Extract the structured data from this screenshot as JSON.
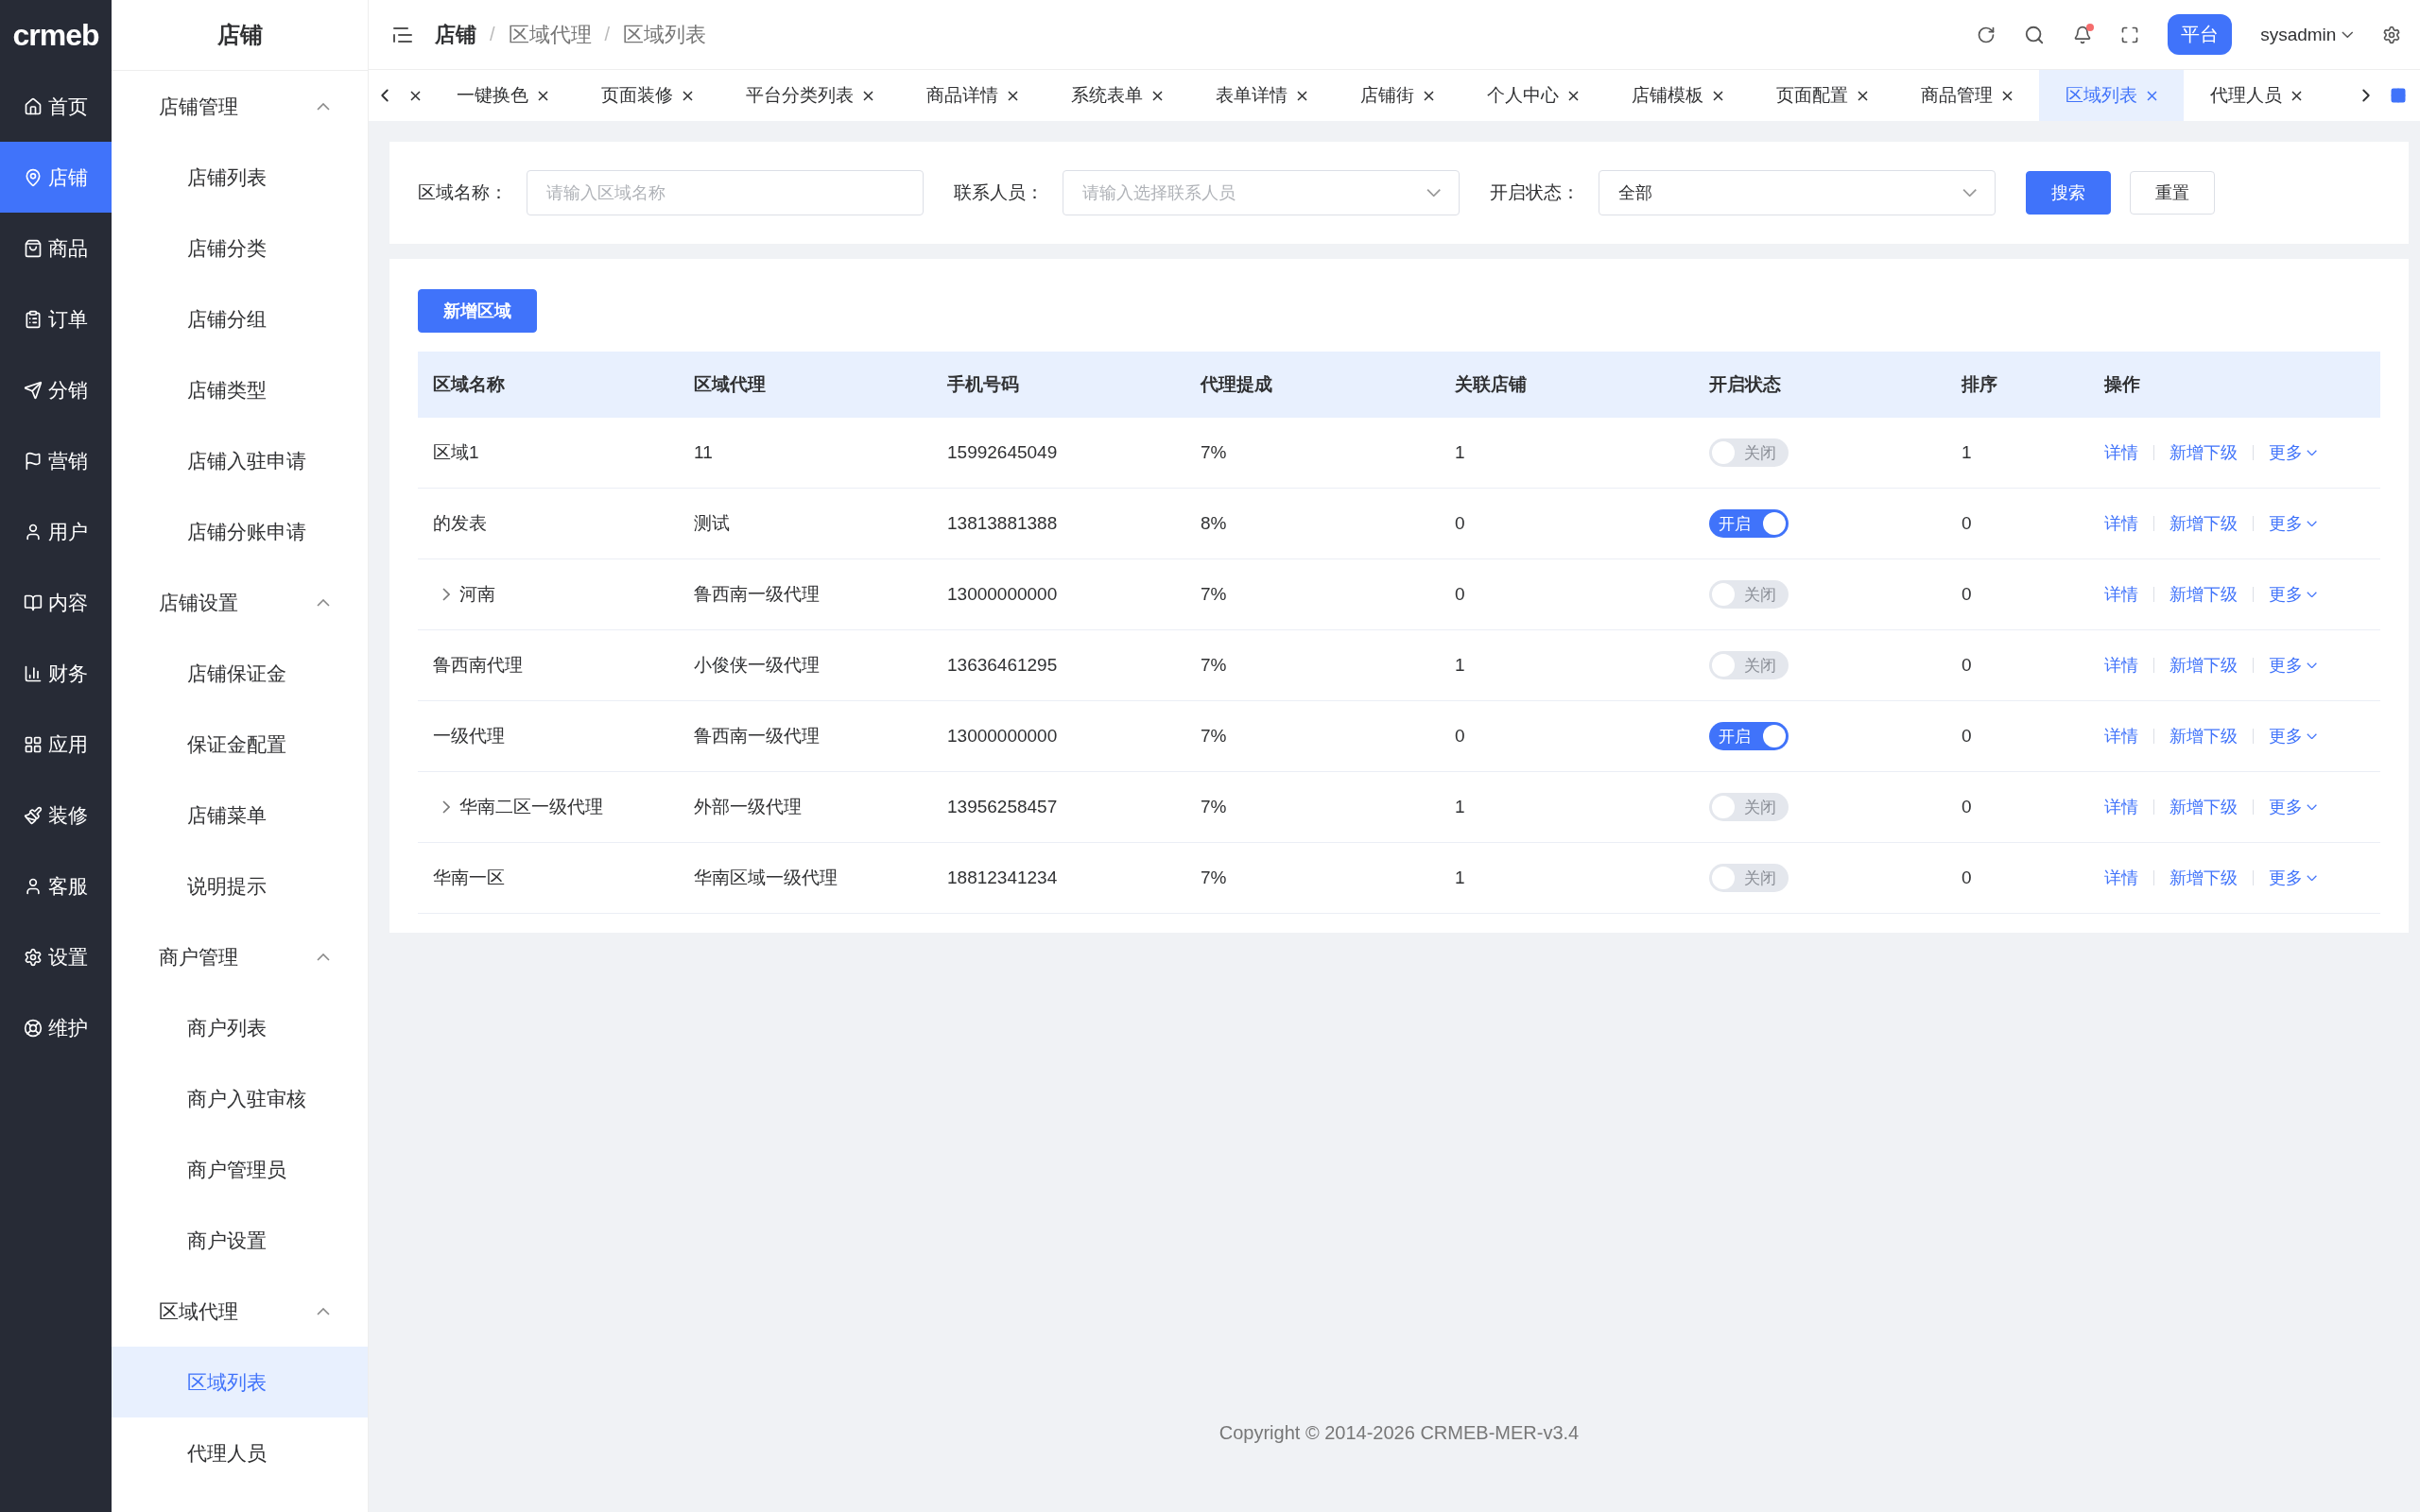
{
  "logo": "crmeb",
  "rail": [
    {
      "label": "首页",
      "selected": false
    },
    {
      "label": "店铺",
      "selected": true
    },
    {
      "label": "商品",
      "selected": false
    },
    {
      "label": "订单",
      "selected": false
    },
    {
      "label": "分销",
      "selected": false
    },
    {
      "label": "营销",
      "selected": false
    },
    {
      "label": "用户",
      "selected": false
    },
    {
      "label": "内容",
      "selected": false
    },
    {
      "label": "财务",
      "selected": false
    },
    {
      "label": "应用",
      "selected": false
    },
    {
      "label": "装修",
      "selected": false
    },
    {
      "label": "客服",
      "selected": false
    },
    {
      "label": "设置",
      "selected": false
    },
    {
      "label": "维护",
      "selected": false
    }
  ],
  "sidebar": {
    "title": "店铺",
    "groups": [
      {
        "label": "店铺管理",
        "expanded": true,
        "items": [
          {
            "label": "店铺列表",
            "selected": false
          },
          {
            "label": "店铺分类",
            "selected": false
          },
          {
            "label": "店铺分组",
            "selected": false
          },
          {
            "label": "店铺类型",
            "selected": false
          },
          {
            "label": "店铺入驻申请",
            "selected": false
          },
          {
            "label": "店铺分账申请",
            "selected": false
          }
        ]
      },
      {
        "label": "店铺设置",
        "expanded": true,
        "items": [
          {
            "label": "店铺保证金",
            "selected": false
          },
          {
            "label": "保证金配置",
            "selected": false
          },
          {
            "label": "店铺菜单",
            "selected": false
          },
          {
            "label": "说明提示",
            "selected": false
          }
        ]
      },
      {
        "label": "商户管理",
        "expanded": true,
        "items": [
          {
            "label": "商户列表",
            "selected": false
          },
          {
            "label": "商户入驻审核",
            "selected": false
          },
          {
            "label": "商户管理员",
            "selected": false
          },
          {
            "label": "商户设置",
            "selected": false
          }
        ]
      },
      {
        "label": "区域代理",
        "expanded": true,
        "items": [
          {
            "label": "区域列表",
            "selected": true
          },
          {
            "label": "代理人员",
            "selected": false
          }
        ]
      }
    ]
  },
  "breadcrumb": [
    "店铺",
    "区域代理",
    "区域列表"
  ],
  "breadcrumb_separators": [
    "/",
    "/"
  ],
  "header": {
    "platform_badge": "平台",
    "user": "sysadmin",
    "notification_dot": true
  },
  "tabs": [
    {
      "selected": false
    },
    {
      "label": "一键换色",
      "selected": false
    },
    {
      "label": "页面装修",
      "selected": false
    },
    {
      "label": "平台分类列表",
      "selected": false
    },
    {
      "label": "商品详情",
      "selected": false
    },
    {
      "label": "系统表单",
      "selected": false
    },
    {
      "label": "表单详情",
      "selected": false
    },
    {
      "label": "店铺街",
      "selected": false
    },
    {
      "label": "个人中心",
      "selected": false
    },
    {
      "label": "店铺模板",
      "selected": false
    },
    {
      "label": "页面配置",
      "selected": false
    },
    {
      "label": "商品管理",
      "selected": false
    },
    {
      "label": "区域列表",
      "selected": true
    },
    {
      "label": "代理人员",
      "selected": false
    }
  ],
  "filters": [
    {
      "label": "区域名称：",
      "kind": "input",
      "placeholder": "请输入区域名称"
    },
    {
      "label": "联系人员：",
      "kind": "select",
      "placeholder": "请输入选择联系人员"
    },
    {
      "label": "开启状态：",
      "kind": "select",
      "value": "全部"
    }
  ],
  "filter_buttons": [
    {
      "label": "搜索",
      "primary": true
    },
    {
      "label": "重置",
      "primary": false
    }
  ],
  "add_button": "新增区域",
  "table": {
    "columns": [
      "区域名称",
      "区域代理",
      "手机号码",
      "代理提成",
      "关联店铺",
      "开启状态",
      "排序",
      "操作"
    ],
    "rows": [
      {
        "name": "区域1",
        "expandable": false,
        "agent": "11",
        "phone": "15992645049",
        "commission": "7%",
        "stores": "1",
        "on": false,
        "switch_label": "关闭",
        "sort": "1",
        "actions": [
          "详情",
          "新增下级",
          "更多"
        ]
      },
      {
        "name": "的发表",
        "expandable": false,
        "agent": "测试",
        "phone": "13813881388",
        "commission": "8%",
        "stores": "0",
        "on": true,
        "switch_label": "开启",
        "sort": "0",
        "actions": [
          "详情",
          "新增下级",
          "更多"
        ]
      },
      {
        "name": "河南",
        "expandable": true,
        "agent": "鲁西南一级代理",
        "phone": "13000000000",
        "commission": "7%",
        "stores": "0",
        "on": false,
        "switch_label": "关闭",
        "sort": "0",
        "actions": [
          "详情",
          "新增下级",
          "更多"
        ]
      },
      {
        "name": "鲁西南代理",
        "expandable": false,
        "agent": "小俊侠一级代理",
        "phone": "13636461295",
        "commission": "7%",
        "stores": "1",
        "on": false,
        "switch_label": "关闭",
        "sort": "0",
        "actions": [
          "详情",
          "新增下级",
          "更多"
        ]
      },
      {
        "name": "一级代理",
        "expandable": false,
        "agent": "鲁西南一级代理",
        "phone": "13000000000",
        "commission": "7%",
        "stores": "0",
        "on": true,
        "switch_label": "开启",
        "sort": "0",
        "actions": [
          "详情",
          "新增下级",
          "更多"
        ]
      },
      {
        "name": "华南二区一级代理",
        "expandable": true,
        "agent": "外部一级代理",
        "phone": "13956258457",
        "commission": "7%",
        "stores": "1",
        "on": false,
        "switch_label": "关闭",
        "sort": "0",
        "actions": [
          "详情",
          "新增下级",
          "更多"
        ]
      },
      {
        "name": "华南一区",
        "expandable": false,
        "agent": "华南区域一级代理",
        "phone": "18812341234",
        "commission": "7%",
        "stores": "1",
        "on": false,
        "switch_label": "关闭",
        "sort": "0",
        "actions": [
          "详情",
          "新增下级",
          "更多"
        ]
      }
    ]
  },
  "footer": "Copyright © 2014-2026 CRMEB-MER-v3.4"
}
